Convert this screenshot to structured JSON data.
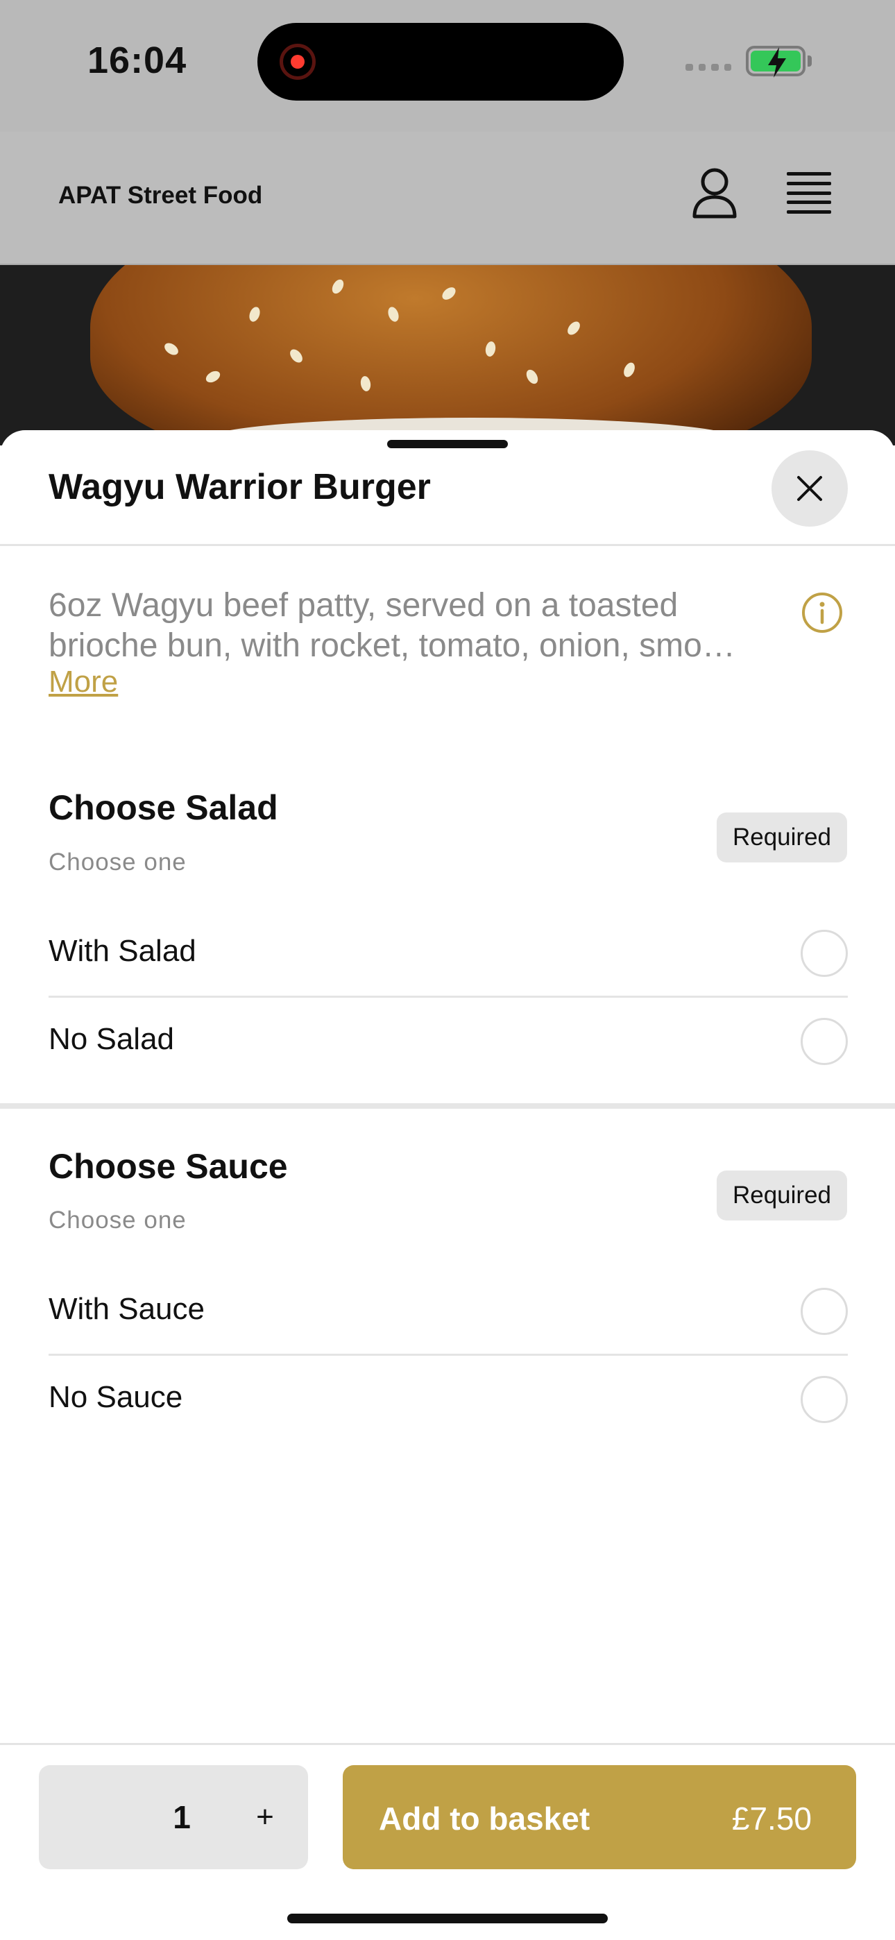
{
  "status_bar": {
    "time": "16:04"
  },
  "header": {
    "brand": "APAT Street Food"
  },
  "item": {
    "title": "Wagyu Warrior Burger",
    "description_line1": "6oz Wagyu beef patty, served on a toasted",
    "description_line2": "brioche bun, with rocket, tomato, onion, smo…",
    "more_label": "More"
  },
  "groups": [
    {
      "title": "Choose Salad",
      "subtitle": "Choose one",
      "badge": "Required",
      "options": [
        {
          "label": "With Salad"
        },
        {
          "label": "No Salad"
        }
      ]
    },
    {
      "title": "Choose Sauce",
      "subtitle": "Choose one",
      "badge": "Required",
      "options": [
        {
          "label": "With Sauce"
        },
        {
          "label": "No Sauce"
        }
      ]
    }
  ],
  "footer": {
    "quantity": "1",
    "plus_label": "+",
    "add_label": "Add to basket",
    "price": "£7.50"
  },
  "colors": {
    "accent": "#c0a146",
    "badge_bg": "#e6e6e6",
    "overlay": "#bcbcbc"
  }
}
